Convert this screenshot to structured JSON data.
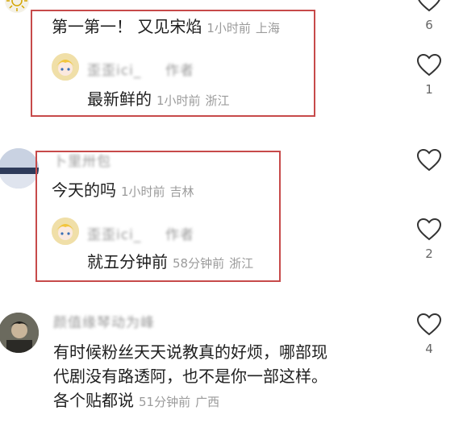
{
  "threads": [
    {
      "comment": {
        "text": "第一第一！ 又见宋焰",
        "time": "1小时前",
        "location": "上海"
      },
      "like_count": "6",
      "reply": {
        "username": "歪歪ici_",
        "author_badge": "作者",
        "text": "最新鲜的",
        "time": "1小时前",
        "location": "浙江",
        "like_count": "1"
      }
    },
    {
      "comment": {
        "username": "卜里卅包",
        "text": "今天的吗",
        "time": "1小时前",
        "location": "吉林"
      },
      "reply": {
        "username": "歪歪ici_",
        "author_badge": "作者",
        "text": "就五分钟前",
        "time": "58分钟前",
        "location": "浙江",
        "like_count": "2"
      }
    },
    {
      "comment": {
        "username": "颜值缘琴动为峰",
        "text_lines": [
          "有时候粉丝天天说教真的好烦，哪部现",
          "代剧没有路透阿，也不是你一部这样。",
          "各个贴都说"
        ],
        "time": "51分钟前",
        "location": "广西",
        "like_count": "4"
      }
    }
  ],
  "icons": {
    "like": "heart-outline-icon"
  },
  "colors": {
    "highlight_box": "#c74a4a",
    "meta_text": "#9b9b9b"
  }
}
